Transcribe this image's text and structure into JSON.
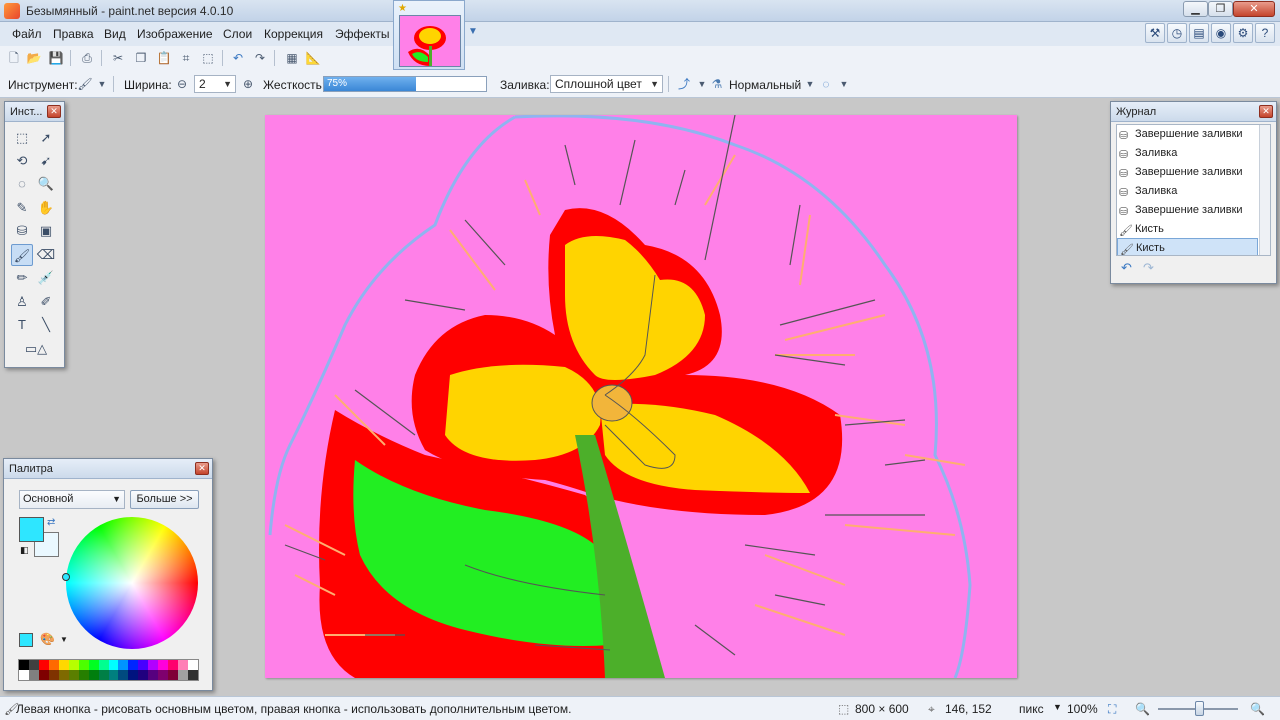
{
  "window": {
    "title": "Безымянный - paint.net версия 4.0.10",
    "min_label": "▁",
    "max_label": "❐",
    "close_label": "✕"
  },
  "menu": {
    "items": [
      "Файл",
      "Правка",
      "Вид",
      "Изображение",
      "Слои",
      "Коррекция",
      "Эффекты"
    ]
  },
  "toolbar": {
    "instrument_label": "Инструмент:",
    "width_label": "Ширина:",
    "width_value": "2",
    "hardness_label": "Жесткость:",
    "hardness_value": "75%",
    "hardness_fraction": 0.75,
    "fill_label": "Заливка:",
    "fill_value": "Сплошной цвет",
    "blend_value": "Нормальный"
  },
  "tools_window": {
    "title": "Инст..."
  },
  "history_window": {
    "title": "Журнал",
    "items": [
      {
        "label": "Завершение заливки",
        "icon": "bucket-icon"
      },
      {
        "label": "Заливка",
        "icon": "bucket-icon"
      },
      {
        "label": "Завершение заливки",
        "icon": "bucket-icon"
      },
      {
        "label": "Заливка",
        "icon": "bucket-icon"
      },
      {
        "label": "Завершение заливки",
        "icon": "bucket-icon"
      },
      {
        "label": "Кисть",
        "icon": "brush-icon"
      },
      {
        "label": "Кисть",
        "icon": "brush-icon",
        "selected": true
      }
    ]
  },
  "palette_window": {
    "title": "Палитра",
    "mode_value": "Основной",
    "more_label": "Больше >>",
    "primary_color": "#2ee6ff",
    "secondary_color": "#eaf8ff"
  },
  "status": {
    "hint": "Левая кнопка - рисовать основным цветом, правая кнопка - использовать дополнительным цветом.",
    "image_size": "800 × 600",
    "cursor_pos": "146, 152",
    "units": "пикс",
    "zoom": "100%"
  },
  "colors": {
    "canvas_bg": "#ff80e8",
    "petal_outline": "#ff0000",
    "petal_fill": "#ffd400",
    "leaf_fill": "#22ee22",
    "stem": "#4caf2a",
    "outline_stroke": "#8fb4f0"
  }
}
